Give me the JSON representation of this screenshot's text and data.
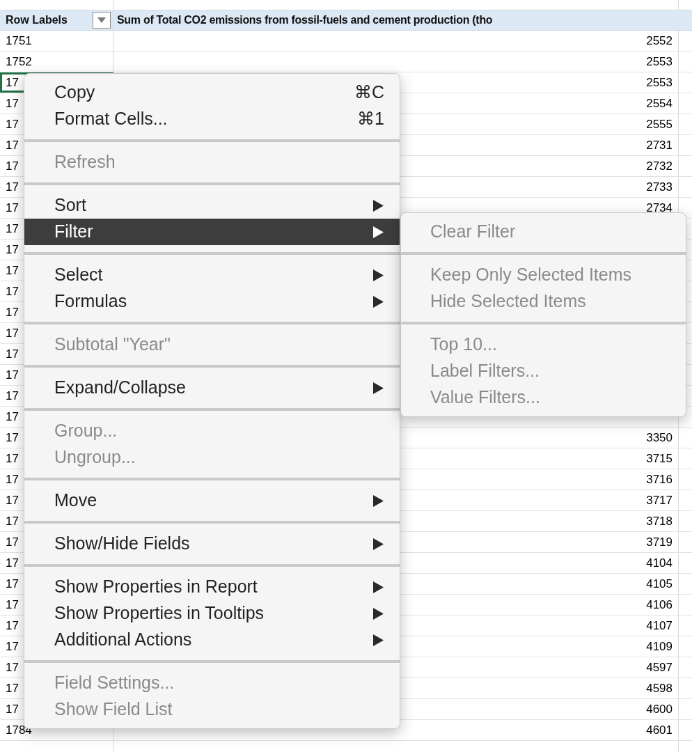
{
  "sheet": {
    "header": {
      "row_labels": "Row Labels",
      "value_header": "Sum of Total CO2 emissions from fossil-fuels and cement production (tho"
    },
    "rows": [
      {
        "label": "1751",
        "value": "2552",
        "selected": false
      },
      {
        "label": "1752",
        "value": "2553",
        "selected": false
      },
      {
        "label": "17",
        "value": "2553",
        "selected": true
      },
      {
        "label": "17",
        "value": "2554",
        "selected": false
      },
      {
        "label": "17",
        "value": "2555",
        "selected": false
      },
      {
        "label": "17",
        "value": "2731",
        "selected": false
      },
      {
        "label": "17",
        "value": "2732",
        "selected": false
      },
      {
        "label": "17",
        "value": "2733",
        "selected": false
      },
      {
        "label": "17",
        "value": "2734",
        "selected": false
      },
      {
        "label": "17",
        "selected": false
      },
      {
        "label": "17",
        "selected": false
      },
      {
        "label": "17",
        "selected": false
      },
      {
        "label": "17",
        "selected": false
      },
      {
        "label": "17",
        "selected": false
      },
      {
        "label": "17",
        "selected": false
      },
      {
        "label": "17",
        "selected": false
      },
      {
        "label": "17",
        "selected": false
      },
      {
        "label": "17",
        "selected": false
      },
      {
        "label": "17",
        "selected": false
      },
      {
        "label": "17",
        "value": "3350",
        "selected": false
      },
      {
        "label": "17",
        "value": "3715",
        "selected": false
      },
      {
        "label": "17",
        "value": "3716",
        "selected": false
      },
      {
        "label": "17",
        "value": "3717",
        "selected": false
      },
      {
        "label": "17",
        "value": "3718",
        "selected": false
      },
      {
        "label": "17",
        "value": "3719",
        "selected": false
      },
      {
        "label": "17",
        "value": "4104",
        "selected": false
      },
      {
        "label": "17",
        "value": "4105",
        "selected": false
      },
      {
        "label": "17",
        "value": "4106",
        "selected": false
      },
      {
        "label": "17",
        "value": "4107",
        "selected": false
      },
      {
        "label": "17",
        "value": "4109",
        "selected": false
      },
      {
        "label": "17",
        "value": "4597",
        "selected": false
      },
      {
        "label": "17",
        "value": "4598",
        "selected": false
      },
      {
        "label": "17",
        "value": "4600",
        "selected": false
      },
      {
        "label": "1784",
        "value": "4601",
        "selected": false
      }
    ]
  },
  "context_menu": {
    "groups": [
      [
        {
          "label": "Copy",
          "shortcut": "⌘C",
          "disabled": false,
          "submenu": false,
          "selected": false
        },
        {
          "label": "Format Cells...",
          "shortcut": "⌘1",
          "disabled": false,
          "submenu": false,
          "selected": false
        }
      ],
      [
        {
          "label": "Refresh",
          "disabled": true,
          "submenu": false,
          "selected": false
        }
      ],
      [
        {
          "label": "Sort",
          "disabled": false,
          "submenu": true,
          "selected": false
        },
        {
          "label": "Filter",
          "disabled": false,
          "submenu": true,
          "selected": true
        }
      ],
      [
        {
          "label": "Select",
          "disabled": false,
          "submenu": true,
          "selected": false
        },
        {
          "label": "Formulas",
          "disabled": false,
          "submenu": true,
          "selected": false
        }
      ],
      [
        {
          "label": "Subtotal \"Year\"",
          "disabled": true,
          "submenu": false,
          "selected": false
        }
      ],
      [
        {
          "label": "Expand/Collapse",
          "disabled": false,
          "submenu": true,
          "selected": false
        }
      ],
      [
        {
          "label": "Group...",
          "disabled": true,
          "submenu": false,
          "selected": false
        },
        {
          "label": "Ungroup...",
          "disabled": true,
          "submenu": false,
          "selected": false
        }
      ],
      [
        {
          "label": "Move",
          "disabled": false,
          "submenu": true,
          "selected": false
        }
      ],
      [
        {
          "label": "Show/Hide Fields",
          "disabled": false,
          "submenu": true,
          "selected": false
        }
      ],
      [
        {
          "label": "Show Properties in Report",
          "disabled": false,
          "submenu": true,
          "selected": false
        },
        {
          "label": "Show Properties in Tooltips",
          "disabled": false,
          "submenu": true,
          "selected": false
        },
        {
          "label": "Additional Actions",
          "disabled": false,
          "submenu": true,
          "selected": false
        }
      ],
      [
        {
          "label": "Field Settings...",
          "disabled": true,
          "submenu": false,
          "selected": false
        },
        {
          "label": "Show Field List",
          "disabled": true,
          "submenu": false,
          "selected": false
        }
      ]
    ]
  },
  "filter_submenu": {
    "groups": [
      [
        {
          "label": "Clear Filter",
          "disabled": true
        }
      ],
      [
        {
          "label": "Keep Only Selected Items",
          "disabled": true
        },
        {
          "label": "Hide Selected Items",
          "disabled": true
        }
      ],
      [
        {
          "label": "Top 10...",
          "disabled": true
        },
        {
          "label": "Label Filters...",
          "disabled": true
        },
        {
          "label": "Value Filters...",
          "disabled": true
        }
      ]
    ]
  }
}
